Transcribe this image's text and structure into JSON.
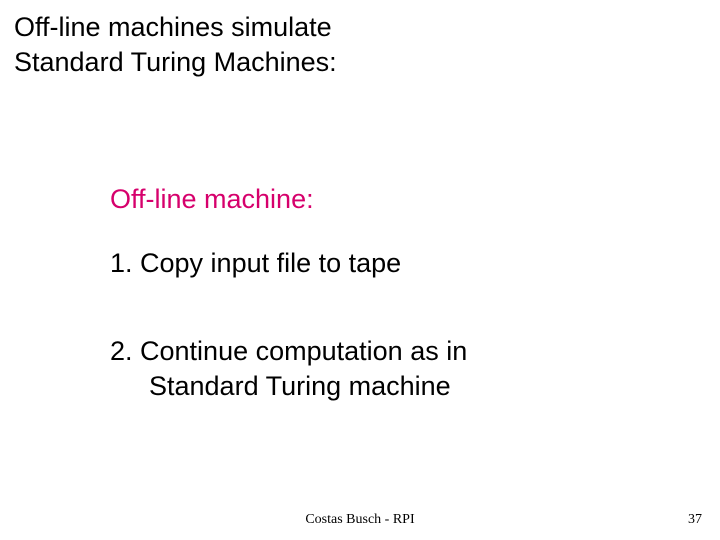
{
  "title_line1": "Off-line machines simulate",
  "title_line2": "Standard Turing Machines:",
  "subhead": "Off-line machine:",
  "step1": "1.  Copy input file to tape",
  "step2_line1": "2.  Continue computation as in",
  "step2_line2": "Standard Turing machine",
  "footer": "Costas Busch - RPI",
  "page_number": "37"
}
